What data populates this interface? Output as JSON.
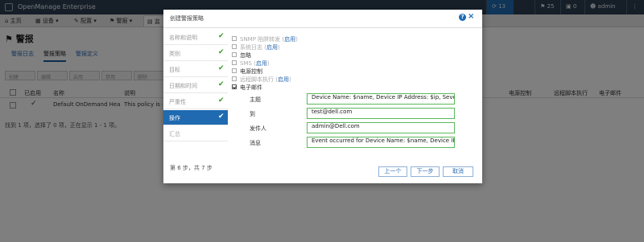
{
  "app": {
    "name": "OpenManage Enterprise",
    "jobs_count": "13",
    "alerts_count": "25",
    "warnings_count": "0",
    "user": "admin"
  },
  "nav": {
    "home": "主页",
    "devices": "设备",
    "configuration": "配置",
    "alerts": "警报",
    "monitor": "监"
  },
  "page": {
    "title": "警报",
    "subtabs": [
      "警报日志",
      "警报策略",
      "警报定义"
    ]
  },
  "toolbar": {
    "buttons": [
      "创建",
      "编辑",
      "启用",
      "禁用",
      "删除"
    ]
  },
  "table": {
    "headers": {
      "enabled": "已启用",
      "name": "名称",
      "description": "说明",
      "power_control": "电源控制",
      "remote_script": "远程脚本执行",
      "email": "电子邮件"
    },
    "row": {
      "name": "Default OnDemand Healt...",
      "description": "This policy is ap"
    },
    "footer": "找到 1 项，选择了 0 项，正在显示 1 - 1 项。"
  },
  "dialog": {
    "title": "创建警报策略",
    "help_icon": "?",
    "close_icon": "×",
    "steps": [
      {
        "label": "名称和说明",
        "done": true
      },
      {
        "label": "类别",
        "done": true
      },
      {
        "label": "目标",
        "done": true
      },
      {
        "label": "日期和时间",
        "done": true
      },
      {
        "label": "严重性",
        "done": true
      },
      {
        "label": "操作",
        "done": true
      },
      {
        "label": "汇总",
        "done": false
      }
    ],
    "actions": {
      "snmp": {
        "text": "SNMP 陷阱转发",
        "link": "启用"
      },
      "syslog": {
        "text": "系统日志",
        "link": "启用"
      },
      "ignore": {
        "text": "忽略"
      },
      "sms": {
        "text": "SMS",
        "link": "启用"
      },
      "power": {
        "text": "电源控制"
      },
      "remote": {
        "text": "远程脚本执行",
        "link": "启用"
      },
      "email": {
        "text": "电子邮件"
      }
    },
    "email_fields": {
      "subject_label": "主题",
      "subject_value": "Device Name: $name,  Device IP Address: $ip,  Severity: $severity",
      "to_label": "到",
      "to_value": "test@dell.com",
      "from_label": "发件人",
      "from_value": "admin@Dell.com",
      "message_label": "消息",
      "message_value": "Event occurred for Device Name: $name, Device IP Address: $ip"
    },
    "step_info": "第 6 步，共 7 步",
    "buttons": {
      "prev": "上一个",
      "next": "下一步",
      "cancel": "取消"
    }
  },
  "colors": {
    "topbar": "#2c3e50",
    "accent": "#1f6ab0",
    "check": "#3a9a2a",
    "valid_border": "#5cb85c"
  }
}
